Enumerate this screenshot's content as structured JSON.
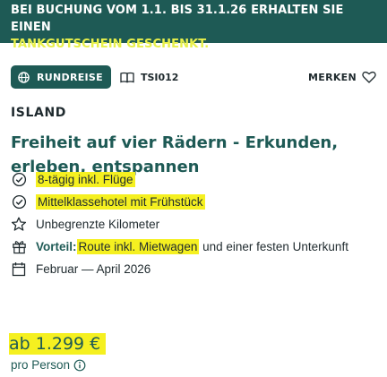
{
  "banner": {
    "line1": "BEI BUCHUNG VOM 1.1. BIS 31.1.26 ERHALTEN SIE EINEN",
    "line2": "TANKGUTSCHEIN GESCHENKT."
  },
  "tags": {
    "type_label": "RUNDREISE",
    "type_icon": "globe-icon",
    "code": "TSI012",
    "code_icon": "book-icon",
    "save_label": "MERKEN",
    "save_icon": "heart-icon"
  },
  "destination": "ISLAND",
  "headline": "Freiheit auf vier Rädern - Erkunden, erleben, entspannen",
  "features": [
    {
      "icon": "check-circle-icon",
      "text": "8-tägig inkl. Flüge"
    },
    {
      "icon": "check-circle-icon",
      "text": "Mittelklassehotel mit Frühstück"
    },
    {
      "icon": "star-outline-icon",
      "text": "Unbegrenzte Kilometer"
    },
    {
      "icon": "gift-icon",
      "label": "Vorteil:",
      "highlight": "Route inkl. Mietwagen",
      "text": " und einer festen Unterkunft"
    },
    {
      "icon": "calendar-icon",
      "text": "Februar — April 2026"
    }
  ],
  "price": {
    "amount": "ab 1.299 €",
    "note": "pro Person",
    "note_icon": "info-icon"
  },
  "colors": {
    "brand": "#1e5a55",
    "banner_highlight": "#e8f04a",
    "marker": "#f5f020"
  }
}
